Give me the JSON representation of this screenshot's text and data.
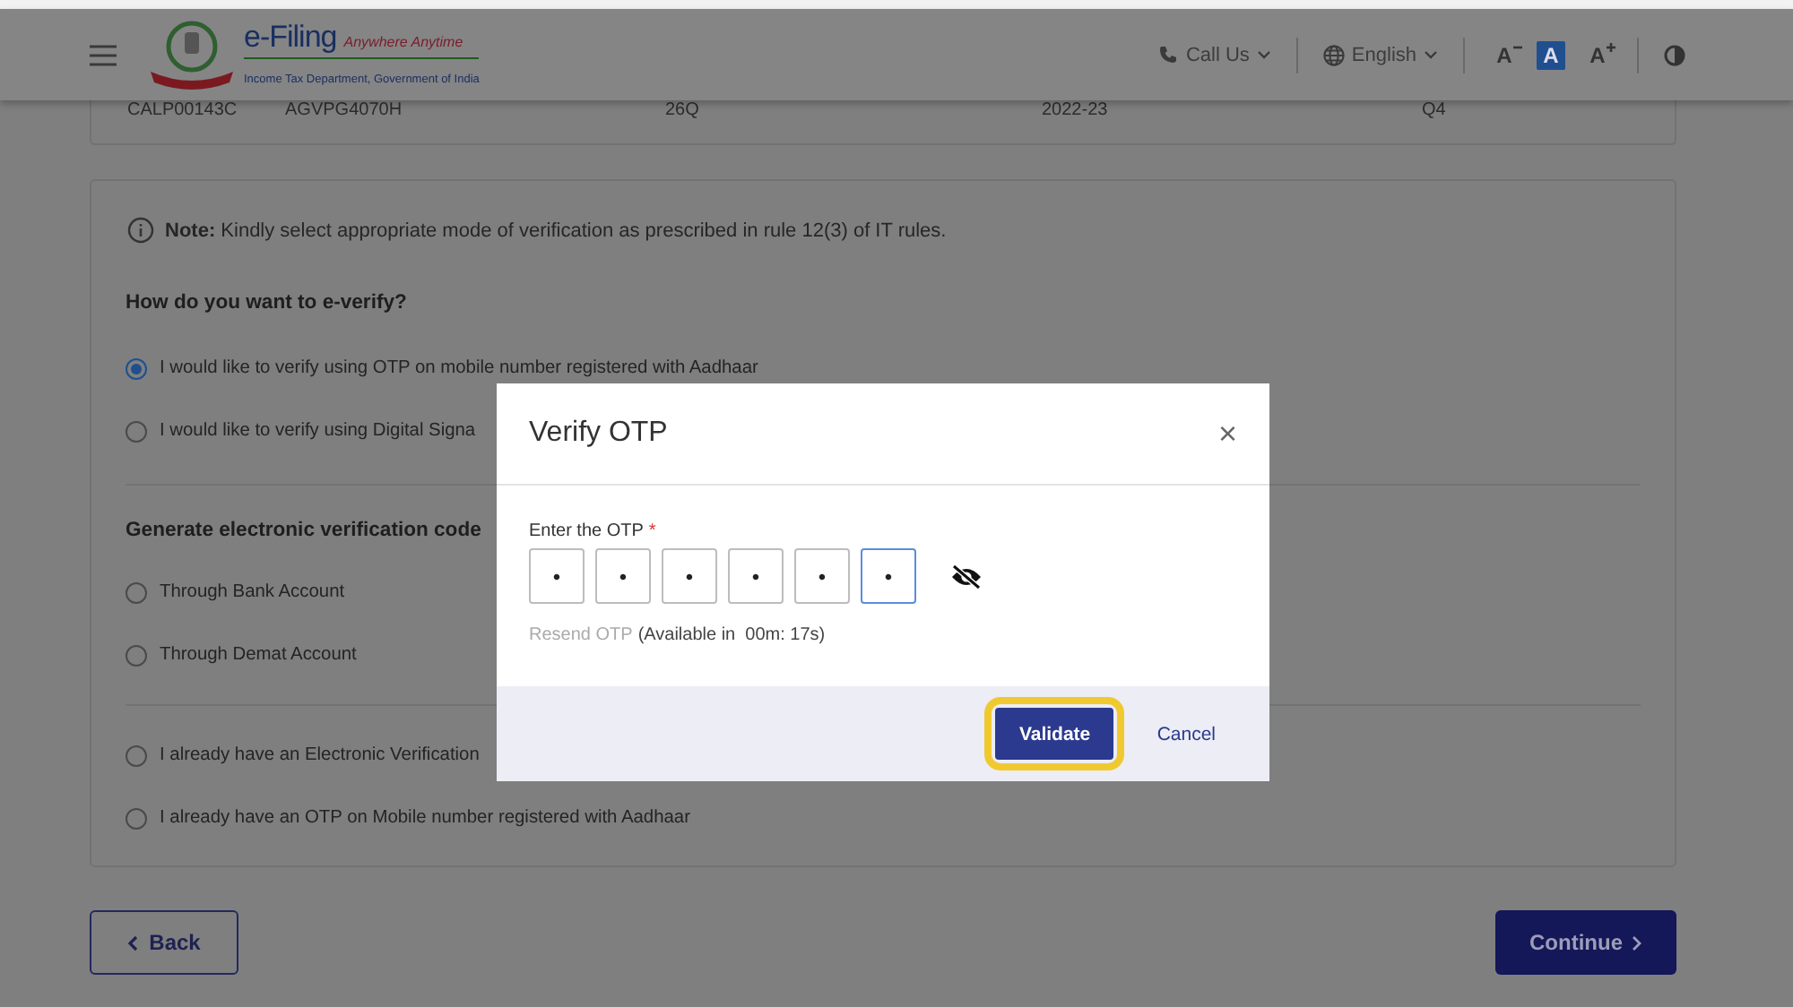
{
  "header": {
    "brand": {
      "name": "e-Filing",
      "tagline": "Anywhere Anytime",
      "subtitle": "Income Tax Department, Government of India"
    },
    "call_us": "Call Us",
    "language": "English",
    "font_sizes": [
      {
        "label": "A",
        "kind": "decrease",
        "selected": false
      },
      {
        "label": "A",
        "kind": "normal",
        "selected": true
      },
      {
        "label": "A",
        "kind": "increase",
        "selected": false
      }
    ]
  },
  "previous_card": {
    "cells": [
      "CALP00143C",
      "AGVPG4070H",
      "26Q",
      "2022-23",
      "Q4"
    ]
  },
  "verification": {
    "note": "**Note:** Kindly select appropriate mode of verification as prescribed in rule 12(3) of IT rules.",
    "question": "How do you want to e-verify?",
    "options": [
      {
        "label": "I would like to verify using OTP on mobile number registered with Aadhaar",
        "selected": true
      },
      {
        "label": "I would like to verify using Digital Signa",
        "selected": false
      }
    ],
    "evc_heading": "Generate electronic verification code",
    "evc_options": [
      {
        "label": "Through Bank Account",
        "selected": false
      },
      {
        "label": "Through Demat Account",
        "selected": false
      }
    ],
    "other_options": [
      {
        "label": "I already have an Electronic Verification",
        "selected": false
      },
      {
        "label": "I already have an OTP on Mobile number registered with Aadhaar",
        "selected": false
      }
    ]
  },
  "dialog": {
    "title": "Verify OTP",
    "close": "×",
    "otp_label": "Enter the OTP",
    "required_mark": "*",
    "otp_digits": [
      {
        "value": "•",
        "focused": false
      },
      {
        "value": "•",
        "focused": false
      },
      {
        "value": "•",
        "focused": false
      },
      {
        "value": "•",
        "focused": false
      },
      {
        "value": "•",
        "focused": false
      },
      {
        "value": "•",
        "focused": true
      }
    ],
    "resend": {
      "label": "Resend OTP",
      "disabled": true
    },
    "availability": "(Available in  00m: 17s)",
    "validate": {
      "label": "Validate",
      "highlighted": true
    },
    "cancel": "Cancel"
  },
  "back_button": "Back",
  "continue_button": "Continue"
}
